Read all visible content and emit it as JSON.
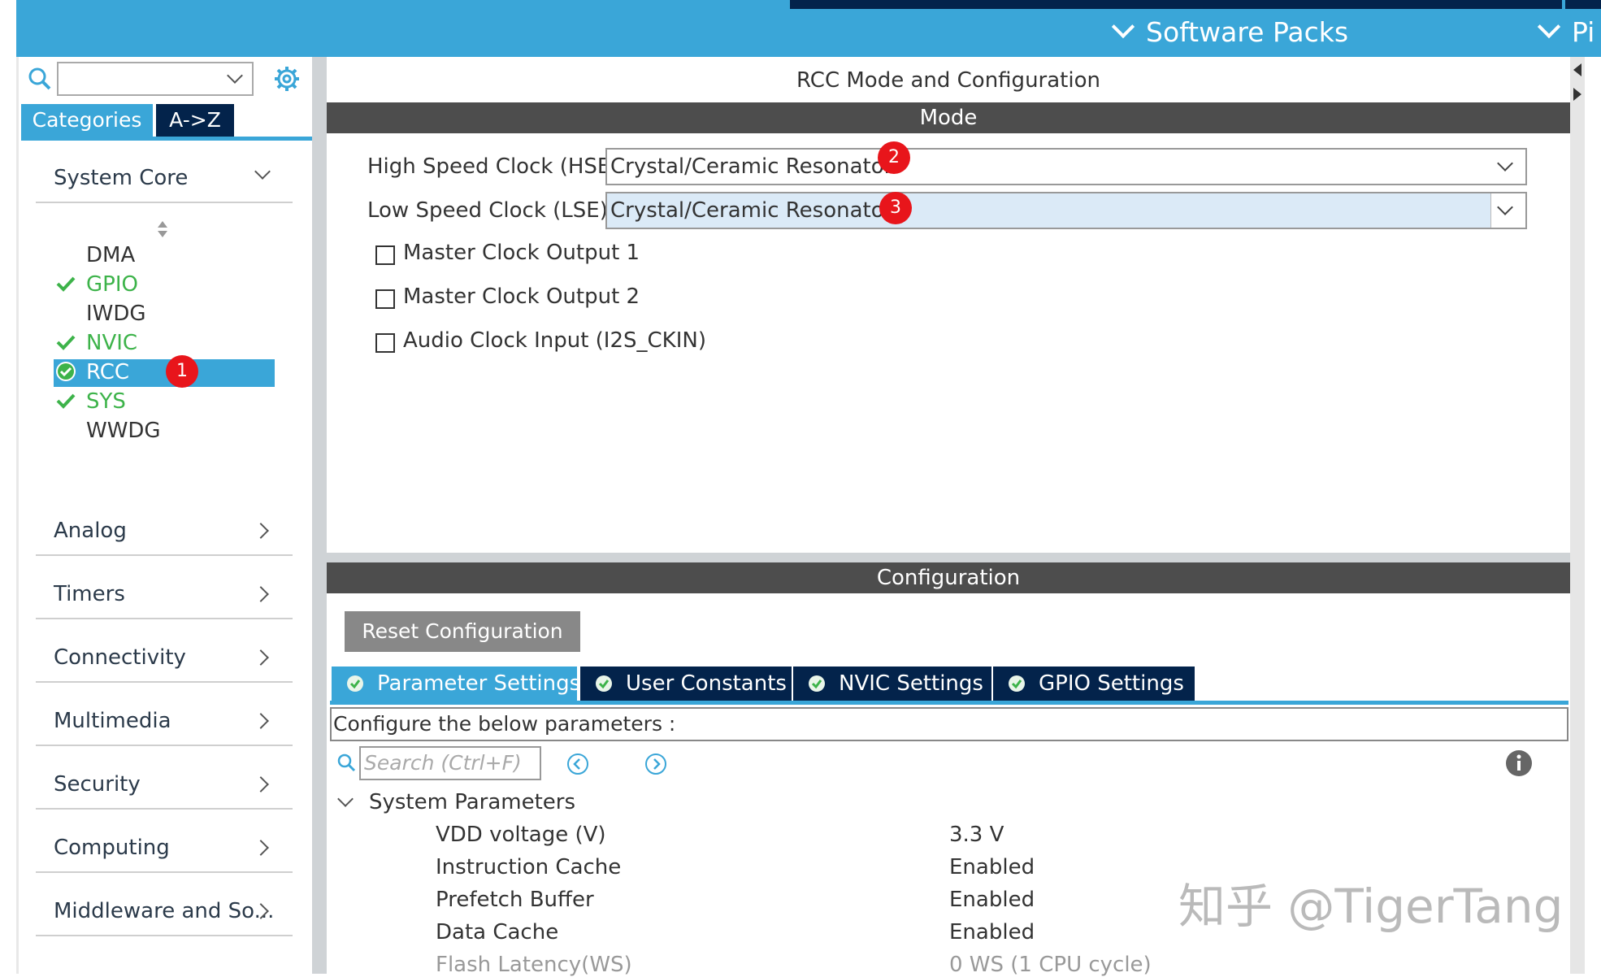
{
  "top_menu": {
    "software_packs": "Software Packs",
    "pinout_partial": "Pi"
  },
  "sidebar": {
    "tab_categories": "Categories",
    "tab_az": "A->Z",
    "categories": [
      {
        "label": "System Core",
        "expanded": true
      },
      {
        "label": "Analog"
      },
      {
        "label": "Timers"
      },
      {
        "label": "Connectivity"
      },
      {
        "label": "Multimedia"
      },
      {
        "label": "Security"
      },
      {
        "label": "Computing"
      },
      {
        "label": "Middleware and So..."
      }
    ],
    "system_core_items": [
      {
        "label": "DMA",
        "status": "none"
      },
      {
        "label": "GPIO",
        "status": "ok"
      },
      {
        "label": "IWDG",
        "status": "none"
      },
      {
        "label": "NVIC",
        "status": "ok"
      },
      {
        "label": "RCC",
        "status": "selected"
      },
      {
        "label": "SYS",
        "status": "ok"
      },
      {
        "label": "WWDG",
        "status": "none"
      }
    ]
  },
  "badges": [
    "1",
    "2",
    "3"
  ],
  "panel": {
    "title": "RCC Mode and Configuration",
    "mode_header": "Mode",
    "hse_label": "High Speed Clock (HSE)",
    "hse_value": "Crystal/Ceramic Resonator",
    "lse_label": "Low Speed Clock (LSE)",
    "lse_value": "Crystal/Ceramic Resonator",
    "checkboxes": [
      {
        "label": "Master Clock Output 1",
        "checked": false
      },
      {
        "label": "Master Clock Output 2",
        "checked": false
      },
      {
        "label": "Audio Clock Input (I2S_CKIN)",
        "checked": false
      }
    ],
    "config_header": "Configuration",
    "reset_button": "Reset Configuration",
    "tabs": [
      {
        "label": "Parameter Settings",
        "active": true
      },
      {
        "label": "User Constants"
      },
      {
        "label": "NVIC Settings"
      },
      {
        "label": "GPIO Settings"
      }
    ],
    "configure_text": "Configure the below parameters :",
    "search_placeholder": "Search (Ctrl+F)",
    "group_label": "System Parameters",
    "params": [
      {
        "name": "VDD voltage (V)",
        "value": "3.3 V"
      },
      {
        "name": "Instruction Cache",
        "value": "Enabled"
      },
      {
        "name": "Prefetch Buffer",
        "value": "Enabled"
      },
      {
        "name": "Data Cache",
        "value": "Enabled"
      },
      {
        "name": "Flash Latency(WS)",
        "value": "0 WS (1 CPU cycle)"
      }
    ]
  },
  "watermark": "知乎 @TigerTang",
  "colors": {
    "accent": "#3aa6d8",
    "navy": "#03234b",
    "ok_green": "#3db34a",
    "badge_red": "#e8151b",
    "section_bar": "#4d4d4d"
  }
}
